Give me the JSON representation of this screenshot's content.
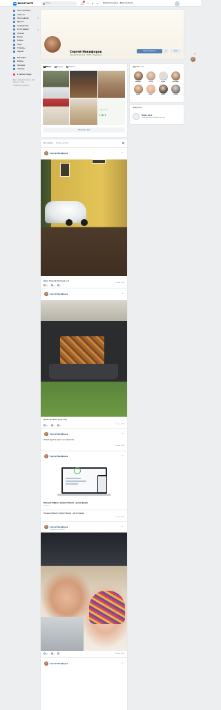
{
  "topbar": {
    "logo_mark": "VK",
    "logo_text": "ВКОНТАКТЕ",
    "search_placeholder": "Поиск",
    "notifications_count": "1",
    "now_playing": "Tamerlan & Alena - Дорогая Пусть"
  },
  "leftnav": {
    "items": [
      {
        "label": "Моя страница",
        "badge": ""
      },
      {
        "label": "Новости",
        "badge": ""
      },
      {
        "label": "Мессенджер",
        "badge": "1"
      },
      {
        "label": "Друзья",
        "badge": ""
      },
      {
        "label": "Сообщества",
        "badge": ""
      },
      {
        "label": "Фотографии",
        "badge": "1"
      },
      {
        "label": "Музыка",
        "badge": ""
      },
      {
        "label": "Видео",
        "badge": ""
      },
      {
        "label": "Клипы",
        "badge": ""
      },
      {
        "label": "Игры",
        "badge": ""
      },
      {
        "label": "Стикеры",
        "badge": ""
      },
      {
        "label": "Маркет",
        "badge": ""
      }
    ],
    "items2": [
      {
        "label": "Закладки"
      },
      {
        "label": "Файлы"
      },
      {
        "label": "Реклама"
      }
    ],
    "items3": [
      {
        "label": "Закладки"
      },
      {
        "label": "Файлы"
      },
      {
        "label": "Реклама"
      },
      {
        "label": "Помощь"
      }
    ],
    "mini_app": "Я люблю пиццу",
    "footer": "Блог · Разработчикам · Для бизнеса · Ещё",
    "footer_link": "Обновить страницу"
  },
  "profile": {
    "name": "Сергей Никифоров",
    "meta": "Нижний Новгород  ·  ЛЭТИ  ·  Подробнее",
    "edit_button": "Редактировать",
    "more_button": "Ещё"
  },
  "photos": {
    "tabs": [
      {
        "label": "Фото",
        "active": true
      },
      {
        "label": "Видео",
        "active": false
      },
      {
        "label": "Клипы",
        "active": false
      }
    ],
    "promo_text": "Смарт-часы",
    "promo_price": "1 399 ₽",
    "show_all": "Показать все"
  },
  "friends": {
    "title": "Друзья",
    "count": "130",
    "list": [
      {
        "name": "Андрей",
        "color": "#8b6a4f"
      },
      {
        "name": "Ольга",
        "color": "#c9a78c"
      },
      {
        "name": "Игорь",
        "color": "#dde3ea"
      },
      {
        "name": "Дмитрий",
        "color": "#a88362"
      },
      {
        "name": "Елена",
        "color": "#b78b6d"
      },
      {
        "name": "Вера",
        "color": "#e0b49a"
      },
      {
        "name": "Павел",
        "color": "#5d5048"
      },
      {
        "name": "Сергей",
        "color": "#7a7f86"
      }
    ]
  },
  "communities": {
    "title": "Подписки",
    "name": "Наша дача",
    "desc": "Садоводство и огородничество"
  },
  "wall": {
    "tabs": [
      {
        "label": "Все записи",
        "muted": false
      },
      {
        "label": "Записи автора",
        "muted": true
      }
    ],
    "author": "Сергей Никифоров",
    "posts": [
      {
        "caption": "Дома, Нижний Новгород 🏡😊",
        "date": "10 апр 2023",
        "likes": "11",
        "comments": "2",
        "reposts": "1"
      },
      {
        "caption": "Дрова для бани (расколол)",
        "date": "17 окт 2020",
        "likes": "13",
        "comments": "3",
        "reposts": "1"
      },
      {
        "caption": "Новый фургон здесь, на горизонте",
        "date": "7 июля 2020",
        "likes": "",
        "comments": "",
        "reposts": ""
      },
      {
        "link_title": "Личный кабинет клиента банка - регистрация",
        "link_sub": "otkritie.ru",
        "date": "",
        "likes": "",
        "comments": "",
        "reposts": ""
      },
      {
        "caption": "Личный кабинет клиента банка - регистрация",
        "date": "1 июля 2020",
        "likes": "",
        "comments": "",
        "reposts": ""
      },
      {
        "sub": "Подробнее о записи",
        "date": "30 дек 2019",
        "likes": "11",
        "comments": "2",
        "reposts": ""
      }
    ]
  }
}
